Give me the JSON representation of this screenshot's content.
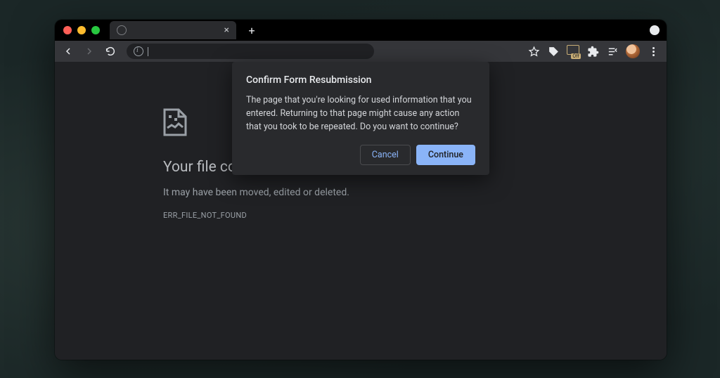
{
  "tab": {
    "title": "",
    "close_glyph": "×"
  },
  "new_tab_glyph": "+",
  "omnibox": {
    "value": "",
    "placeholder": ""
  },
  "translate_badge": "Off",
  "error_page": {
    "heading": "Your file couldn't be accessed",
    "subtext": "It may have been moved, edited or deleted.",
    "code": "ERR_FILE_NOT_FOUND"
  },
  "dialog": {
    "title": "Confirm Form Resubmission",
    "body": "The page that you're looking for used information that you entered. Returning to that page might cause any action that you took to be repeated. Do you want to continue?",
    "cancel": "Cancel",
    "continue": "Continue"
  }
}
